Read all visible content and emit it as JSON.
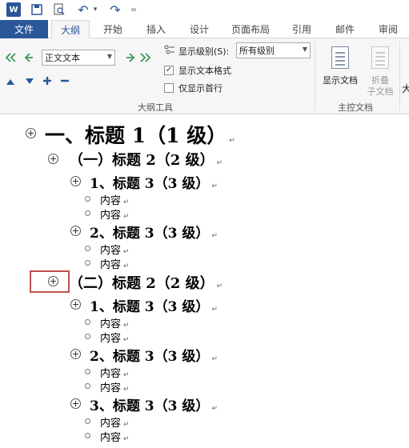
{
  "quick_access": {
    "app_logo": "W",
    "undo_symbol": "↶",
    "redo_symbol": "↷",
    "dropdown_symbol": "▾",
    "customize_symbol": "="
  },
  "tabs": {
    "file": "文件",
    "items": [
      {
        "label": "大纲",
        "active": true
      },
      {
        "label": "开始"
      },
      {
        "label": "插入"
      },
      {
        "label": "设计"
      },
      {
        "label": "页面布局"
      },
      {
        "label": "引用"
      },
      {
        "label": "邮件"
      },
      {
        "label": "审阅"
      }
    ]
  },
  "ribbon": {
    "outline_tools": {
      "level_value": "正文文本",
      "show_level_label": "显示级别(S):",
      "show_level_value": "所有级别",
      "show_text_format": "显示文本格式",
      "show_text_format_checked": true,
      "show_first_line": "仅显示首行",
      "show_first_line_checked": false,
      "group_label": "大纲工具"
    },
    "master_document": {
      "show_document": "显示文档",
      "collapse_line1": "折叠",
      "collapse_line2": "子文档",
      "group_label": "主控文档"
    },
    "clipped_text": "大"
  },
  "outline": {
    "para_mark": "↵",
    "h1": "一、标题 1（1 级）",
    "h2_first": "（一）标题 2（2 级）",
    "h2_second": "（二）标题 2（2 级）",
    "h3_a": "1、标题 3（3 级）",
    "h3_b": "2、标题 3（3 级）",
    "h3_c": "3、标题 3（3 级）",
    "content": "内容"
  },
  "colors": {
    "accent": "#2b579a",
    "highlight": "#c0504d"
  }
}
